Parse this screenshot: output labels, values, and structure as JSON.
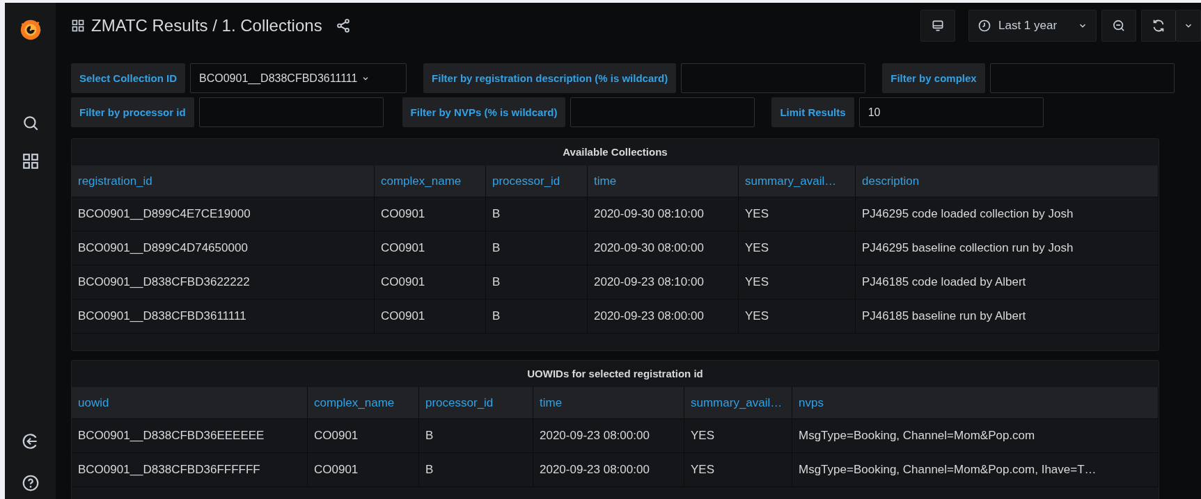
{
  "header": {
    "title": "ZMATC Results / 1. Collections",
    "time_range": "Last 1 year"
  },
  "filters": [
    [
      {
        "label": "Select Collection ID",
        "kind": "select",
        "value": "BCO0901__D838CFBD3611111"
      },
      {
        "label": "Filter by registration description (% is wildcard)",
        "kind": "input"
      },
      {
        "label": "Filter by complex",
        "kind": "input"
      }
    ],
    [
      {
        "label": "Filter by processor id",
        "kind": "input"
      },
      {
        "label": "Filter by NVPs (% is wildcard)",
        "kind": "input"
      },
      {
        "label": "Limit Results",
        "kind": "input",
        "value": "10"
      }
    ]
  ],
  "panels": [
    {
      "title": "Available Collections",
      "columns": [
        "registration_id",
        "complex_name",
        "processor_id",
        "time",
        "summary_avail…",
        "description"
      ],
      "rows": [
        [
          "BCO0901__D899C4E7CE19000",
          "CO0901",
          "B",
          "2020-09-30 08:10:00",
          "YES",
          "PJ46295 code loaded collection by Josh"
        ],
        [
          "BCO0901__D899C4D74650000",
          "CO0901",
          "B",
          "2020-09-30 08:00:00",
          "YES",
          "PJ46295 baseline collection run by Josh"
        ],
        [
          "BCO0901__D838CFBD3622222",
          "CO0901",
          "B",
          "2020-09-23 08:10:00",
          "YES",
          "PJ46185 code loaded by Albert"
        ],
        [
          "BCO0901__D838CFBD3611111",
          "CO0901",
          "B",
          "2020-09-23 08:00:00",
          "YES",
          "PJ46185 baseline run by Albert"
        ]
      ]
    },
    {
      "title": "UOWIDs for selected registration id",
      "columns": [
        "uowid",
        "complex_name",
        "processor_id",
        "time",
        "summary_avail…",
        "nvps"
      ],
      "rows": [
        [
          "BCO0901__D838CFBD36EEEEEE",
          "CO0901",
          "B",
          "2020-09-23 08:00:00",
          "YES",
          "MsgType=Booking, Channel=Mom&Pop.com"
        ],
        [
          "BCO0901__D838CFBD36FFFFFF",
          "CO0901",
          "B",
          "2020-09-23 08:00:00",
          "YES",
          "MsgType=Booking, Channel=Mom&Pop.com, Ihave=T…"
        ]
      ]
    }
  ]
}
